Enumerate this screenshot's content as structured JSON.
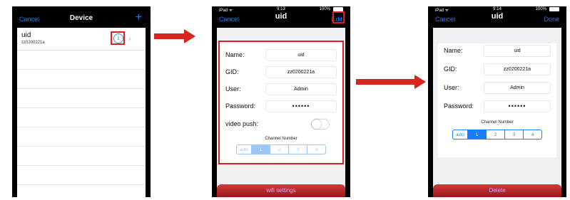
{
  "screen1": {
    "nav_left": "Cancel",
    "title": "Device",
    "nav_right_icon": "+",
    "device": {
      "name": "uid",
      "uid": "zz0200221a"
    },
    "info_icon": "i",
    "chevron_icon": "›"
  },
  "screen2": {
    "status": {
      "carrier": "iPad ᯤ",
      "time": "9:13",
      "battery": "100%"
    },
    "nav_left": "Cancel",
    "title": "uid",
    "nav_right": "Edit",
    "fields": [
      {
        "label": "Name:",
        "value": "uid"
      },
      {
        "label": "GID:",
        "value": "zz0200221a"
      },
      {
        "label": "User:",
        "value": "Admin"
      },
      {
        "label": "Password:",
        "value": "••••••"
      }
    ],
    "video_push_label": "video push:",
    "channel_label": "Channel Number",
    "channels": [
      "auto",
      "1",
      "2",
      "3",
      "4"
    ],
    "bottom_button": "wifi settings"
  },
  "screen3": {
    "status": {
      "carrier": "iPad ᯤ",
      "time": "9:14",
      "battery": "100%"
    },
    "nav_left": "Cancel",
    "title": "uid",
    "nav_right": "Done",
    "fields": [
      {
        "label": "Name:",
        "value": "uid"
      },
      {
        "label": "GID:",
        "value": "zz0200221a"
      },
      {
        "label": "User:",
        "value": "Admin"
      },
      {
        "label": "Password:",
        "value": "••••••"
      }
    ],
    "channel_label": "Channel Number",
    "channels": [
      "auto",
      "1",
      "2",
      "3",
      "4"
    ],
    "bottom_button": "Delete"
  },
  "colors": {
    "accent": "#1a7dff",
    "highlight": "#e02020",
    "arrow": "#d7261e",
    "button": "#b02020"
  }
}
